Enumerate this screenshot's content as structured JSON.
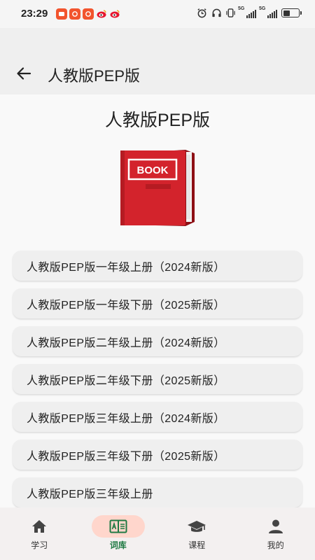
{
  "status_bar": {
    "time": "23:29",
    "notification_icons": [
      "app-notification-icon",
      "app-notification-icon",
      "app-notification-icon",
      "weibo-icon",
      "weibo-icon"
    ],
    "right_icons": [
      "alarm-icon",
      "headphones-icon",
      "vibrate-icon",
      "signal-5g-icon",
      "signal-5g-icon",
      "battery-icon"
    ],
    "signal_tag": "5G"
  },
  "app_bar": {
    "back_icon": "arrow-left-icon",
    "title": "人教版PEP版"
  },
  "page": {
    "title": "人教版PEP版",
    "book_label": "BOOK"
  },
  "volumes": [
    "人教版PEP版一年级上册（2024新版）",
    "人教版PEP版一年级下册（2025新版）",
    "人教版PEP版二年级上册（2024新版）",
    "人教版PEP版二年级下册（2025新版）",
    "人教版PEP版三年级上册（2024新版）",
    "人教版PEP版三年级下册（2025新版）",
    "人教版PEP版三年级上册"
  ],
  "bottom_nav": [
    {
      "label": "学习",
      "icon": "home-icon"
    },
    {
      "label": "词库",
      "icon": "dictionary-icon",
      "active": true
    },
    {
      "label": "课程",
      "icon": "graduation-cap-icon"
    },
    {
      "label": "我的",
      "icon": "person-icon"
    }
  ],
  "colors": {
    "accent": "#1f7a43",
    "active_pill": "#ffd6cc",
    "book_red": "#d3232c"
  }
}
